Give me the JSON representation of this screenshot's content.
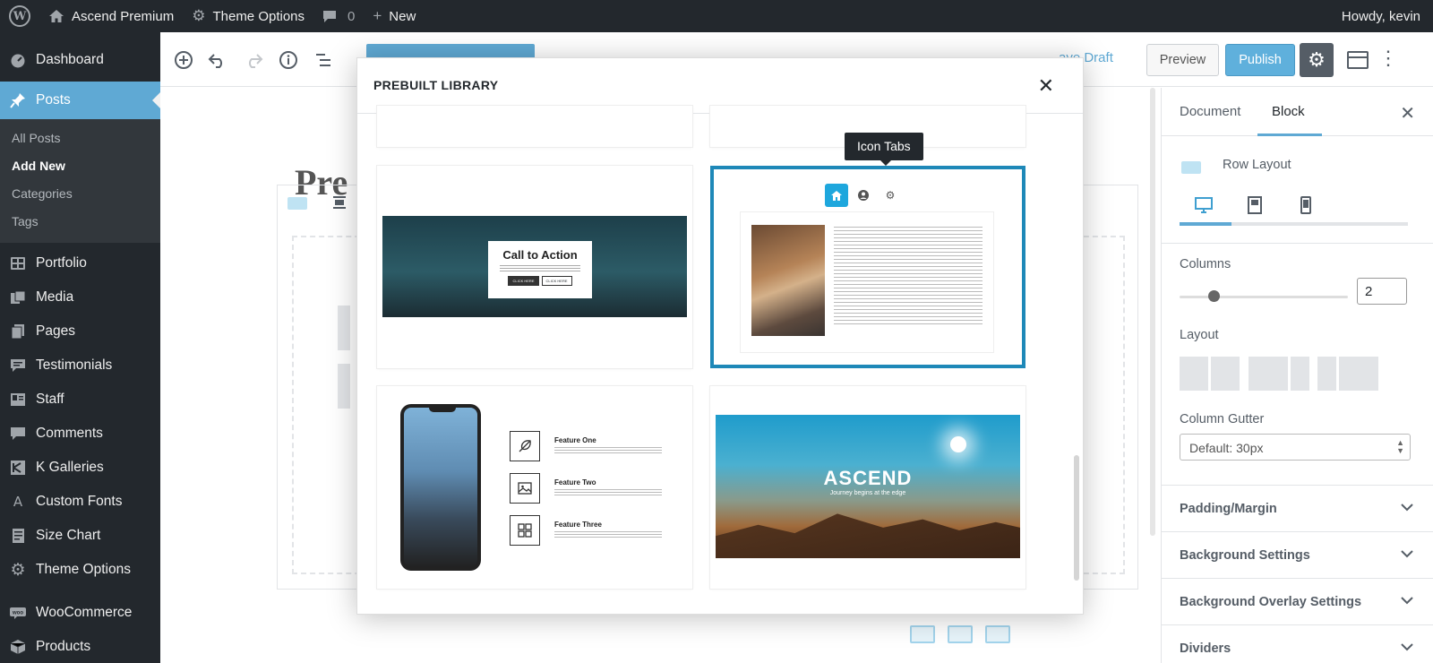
{
  "admin_bar": {
    "site_name": "Ascend Premium",
    "theme_options": "Theme Options",
    "comments_count": "0",
    "new_label": "New",
    "howdy": "Howdy, kevin"
  },
  "sidebar": {
    "items_top": [
      {
        "label": "Dashboard",
        "icon": "dashboard-icon"
      }
    ],
    "current": {
      "label": "Posts",
      "icon": "pin-icon"
    },
    "submenu": [
      "All Posts",
      "Add New",
      "Categories",
      "Tags"
    ],
    "submenu_active": "Add New",
    "items": [
      {
        "label": "Portfolio",
        "icon": "portfolio-icon"
      },
      {
        "label": "Media",
        "icon": "media-icon"
      },
      {
        "label": "Pages",
        "icon": "pages-icon"
      },
      {
        "label": "Testimonials",
        "icon": "testimonials-icon"
      },
      {
        "label": "Staff",
        "icon": "staff-icon"
      },
      {
        "label": "Comments",
        "icon": "comments-icon"
      },
      {
        "label": "K Galleries",
        "icon": "galleries-icon"
      },
      {
        "label": "Custom Fonts",
        "icon": "fonts-icon"
      },
      {
        "label": "Size Chart",
        "icon": "size-chart-icon"
      },
      {
        "label": "Theme Options",
        "icon": "gear-icon"
      }
    ],
    "items_bottom": [
      {
        "label": "WooCommerce",
        "icon": "woocommerce-icon"
      },
      {
        "label": "Products",
        "icon": "products-icon"
      }
    ]
  },
  "toolbar": {
    "save_draft": "ave Draft",
    "preview": "Preview",
    "publish": "Publish"
  },
  "canvas": {
    "ghost_title": "Pre"
  },
  "modal": {
    "title": "PREBUILT LIBRARY",
    "tooltip": "Icon Tabs",
    "cta_heading": "Call to Action",
    "cta_btn_1": "CLICK HERE",
    "cta_btn_2": "CLICK HERE",
    "features": [
      "Feature One",
      "Feature Two",
      "Feature Three"
    ],
    "hero_title": "ASCEND",
    "hero_subtitle": "Journey begins at the edge"
  },
  "right_sidebar": {
    "tab_document": "Document",
    "tab_block": "Block",
    "block_name": "Row Layout",
    "columns_label": "Columns",
    "columns_value": "2",
    "columns_slider_fraction": 0.2,
    "layout_label": "Layout",
    "gutter_label": "Column Gutter",
    "gutter_value": "Default: 30px",
    "panels": [
      "Padding/Margin",
      "Background Settings",
      "Background Overlay Settings",
      "Dividers"
    ]
  },
  "colors": {
    "admin_dark": "#23282d",
    "accent_blue": "#5fa9d4",
    "selected_border": "#1e88b8"
  }
}
